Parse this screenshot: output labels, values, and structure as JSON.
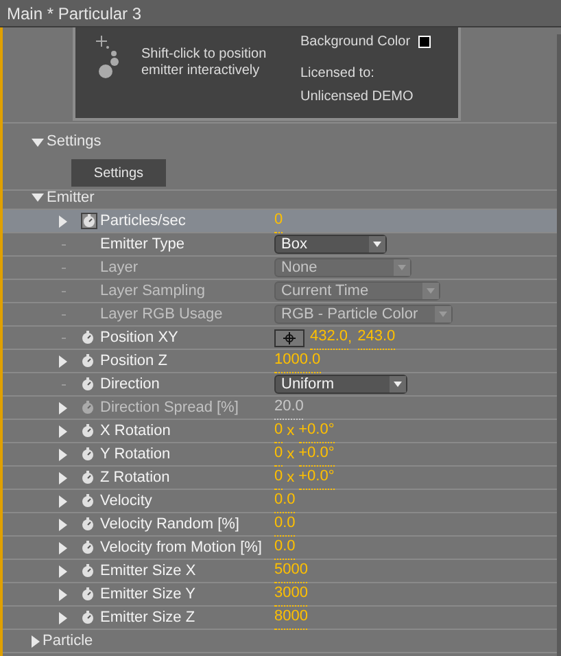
{
  "window": {
    "title": "Main * Particular 3"
  },
  "preview": {
    "hint": "Shift-click to position emitter interactively",
    "background_color": {
      "label": "Background Color",
      "color": "#000000"
    },
    "license_label": "Licensed to:",
    "license_name": "Unlicensed DEMO"
  },
  "sections": [
    {
      "label": "Settings",
      "expanded": true,
      "button": "Settings"
    },
    {
      "label": "Emitter",
      "expanded": true
    }
  ],
  "rows": [
    {
      "kind": "number",
      "label": "Particles/sec",
      "twirl": true,
      "stopwatch": true,
      "selected": true,
      "disabled": false,
      "value": "0"
    },
    {
      "kind": "dropdown",
      "label": "Emitter Type",
      "twirl": false,
      "stopwatch": false,
      "selected": false,
      "disabled": false,
      "value": "Box"
    },
    {
      "kind": "dropdown",
      "label": "Layer",
      "twirl": false,
      "stopwatch": false,
      "selected": false,
      "disabled": true,
      "value": "None"
    },
    {
      "kind": "dropdown",
      "label": "Layer Sampling",
      "twirl": false,
      "stopwatch": false,
      "selected": false,
      "disabled": true,
      "value": "Current Time"
    },
    {
      "kind": "dropdown",
      "label": "Layer RGB Usage",
      "twirl": false,
      "stopwatch": false,
      "selected": false,
      "disabled": true,
      "value": "RGB - Particle Color"
    },
    {
      "kind": "position",
      "label": "Position XY",
      "twirl": false,
      "stopwatch": true,
      "selected": false,
      "disabled": false,
      "values": [
        "432.0",
        "243.0"
      ],
      "separator": ","
    },
    {
      "kind": "number",
      "label": "Position Z",
      "twirl": true,
      "stopwatch": true,
      "selected": false,
      "disabled": false,
      "value": "1000.0"
    },
    {
      "kind": "dropdown",
      "label": "Direction",
      "twirl": false,
      "stopwatch": true,
      "selected": false,
      "disabled": false,
      "value": "Uniform"
    },
    {
      "kind": "number",
      "label": "Direction Spread [%]",
      "twirl": true,
      "stopwatch": true,
      "selected": false,
      "disabled": true,
      "value": "20.0"
    },
    {
      "kind": "rotation",
      "label": "X Rotation",
      "twirl": true,
      "stopwatch": true,
      "selected": false,
      "disabled": false,
      "values": [
        "0",
        "+0.0°"
      ],
      "separator": "x"
    },
    {
      "kind": "rotation",
      "label": "Y Rotation",
      "twirl": true,
      "stopwatch": true,
      "selected": false,
      "disabled": false,
      "values": [
        "0",
        "+0.0°"
      ],
      "separator": "x"
    },
    {
      "kind": "rotation",
      "label": "Z Rotation",
      "twirl": true,
      "stopwatch": true,
      "selected": false,
      "disabled": false,
      "values": [
        "0",
        "+0.0°"
      ],
      "separator": "x"
    },
    {
      "kind": "number",
      "label": "Velocity",
      "twirl": true,
      "stopwatch": true,
      "selected": false,
      "disabled": false,
      "value": "0.0"
    },
    {
      "kind": "number",
      "label": "Velocity Random [%]",
      "twirl": true,
      "stopwatch": true,
      "selected": false,
      "disabled": false,
      "value": "0.0"
    },
    {
      "kind": "number",
      "label": "Velocity from Motion [%]",
      "twirl": true,
      "stopwatch": true,
      "selected": false,
      "disabled": false,
      "value": "0.0"
    },
    {
      "kind": "number",
      "label": "Emitter Size X",
      "twirl": true,
      "stopwatch": true,
      "selected": false,
      "disabled": false,
      "value": "5000"
    },
    {
      "kind": "number",
      "label": "Emitter Size Y",
      "twirl": true,
      "stopwatch": true,
      "selected": false,
      "disabled": false,
      "value": "3000"
    },
    {
      "kind": "number",
      "label": "Emitter Size Z",
      "twirl": true,
      "stopwatch": true,
      "selected": false,
      "disabled": false,
      "value": "8000"
    }
  ],
  "footer_section": {
    "label": "Particle",
    "expanded": false
  }
}
